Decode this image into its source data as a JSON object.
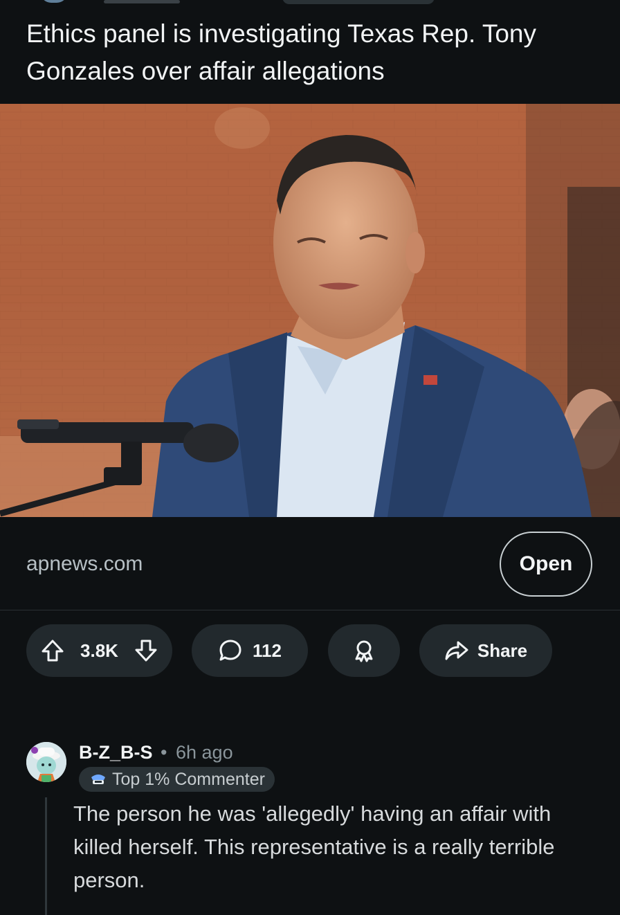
{
  "post": {
    "title": "Ethics panel is investigating Texas Rep. Tony Gonzales over affair allegations",
    "link_domain": "apnews.com",
    "open_label": "Open"
  },
  "actions": {
    "upvote_count": "3.8K",
    "comment_count": "112",
    "share_label": "Share"
  },
  "comment": {
    "username": "B-Z_B-S",
    "separator": "•",
    "age": "6h ago",
    "badge": "Top 1% Commenter",
    "body": "The person he was 'allegedly' having an affair with killed herself. This representative is a really terrible person."
  },
  "colors": {
    "background": "#0e1113",
    "pill": "#22292d",
    "muted_text": "#8a959b"
  },
  "icons": [
    "upvote-icon",
    "downvote-icon",
    "comment-icon",
    "award-icon",
    "share-icon",
    "badge-icon"
  ]
}
